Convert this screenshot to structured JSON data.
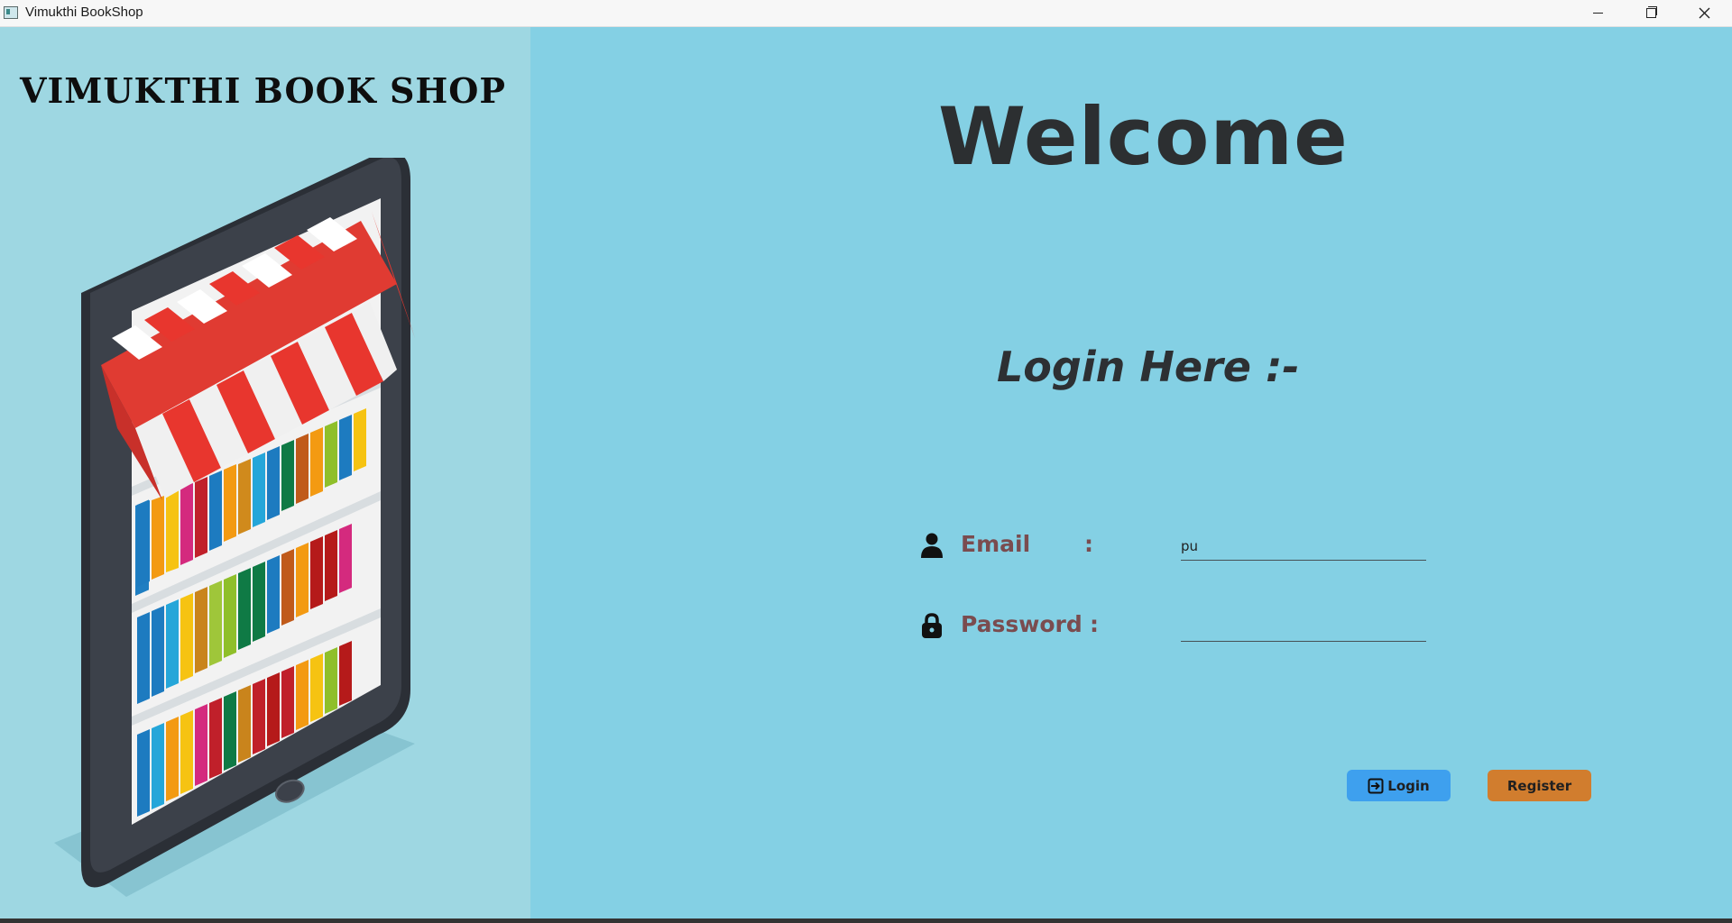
{
  "window": {
    "title": "Vimukthi BookShop"
  },
  "left": {
    "shop_name": "VIMUKTHI BOOK SHOP"
  },
  "main": {
    "welcome": "Welcome",
    "login_heading": "Login Here :-",
    "email": {
      "label": "Email",
      "colon": ":",
      "value": "pu",
      "icon": "user-icon"
    },
    "password": {
      "label": "Password",
      "colon": ":",
      "value": "",
      "icon": "lock-icon"
    },
    "buttons": {
      "login": "Login",
      "register": "Register"
    }
  },
  "colors": {
    "background": "#84d0e4",
    "left_panel": "#9ed7e2",
    "label": "#7a4c4f",
    "login_button": "#3ea0ee",
    "register_button": "#d17d2e"
  }
}
